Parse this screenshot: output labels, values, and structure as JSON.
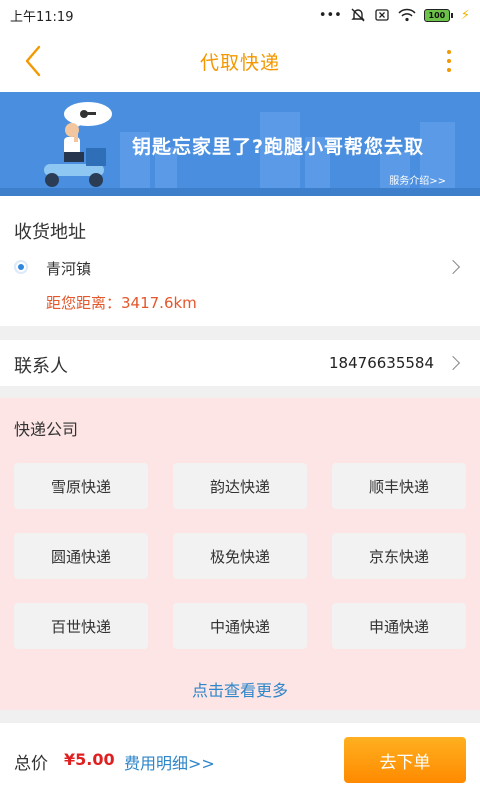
{
  "status_bar": {
    "time": "上午11:19",
    "battery": "100"
  },
  "header": {
    "title": "代取快递"
  },
  "banner": {
    "slogan": "钥匙忘家里了?跑腿小哥帮您去取",
    "intro_link": "服务介绍>>",
    "bg_color": "#4a8fdf"
  },
  "address": {
    "section_label": "收货地址",
    "name": "青河镇",
    "distance": "距您距离：3417.6km"
  },
  "contact": {
    "label": "联系人",
    "phone": "18476635584"
  },
  "express": {
    "title": "快递公司",
    "companies": [
      "雪原快递",
      "韵达快递",
      "顺丰快递",
      "圆通快递",
      "极免快递",
      "京东快递",
      "百世快递",
      "中通快递",
      "申通快递"
    ],
    "more": "点击查看更多",
    "bg_color": "#fde5e5"
  },
  "footer": {
    "total_label": "总价",
    "total_price": "¥5.00",
    "fee_detail": "费用明细>>",
    "order_button": "去下单"
  },
  "colors": {
    "accent": "#f39800",
    "link": "#2f86c9",
    "price": "#e02020",
    "distance": "#e4572b"
  }
}
